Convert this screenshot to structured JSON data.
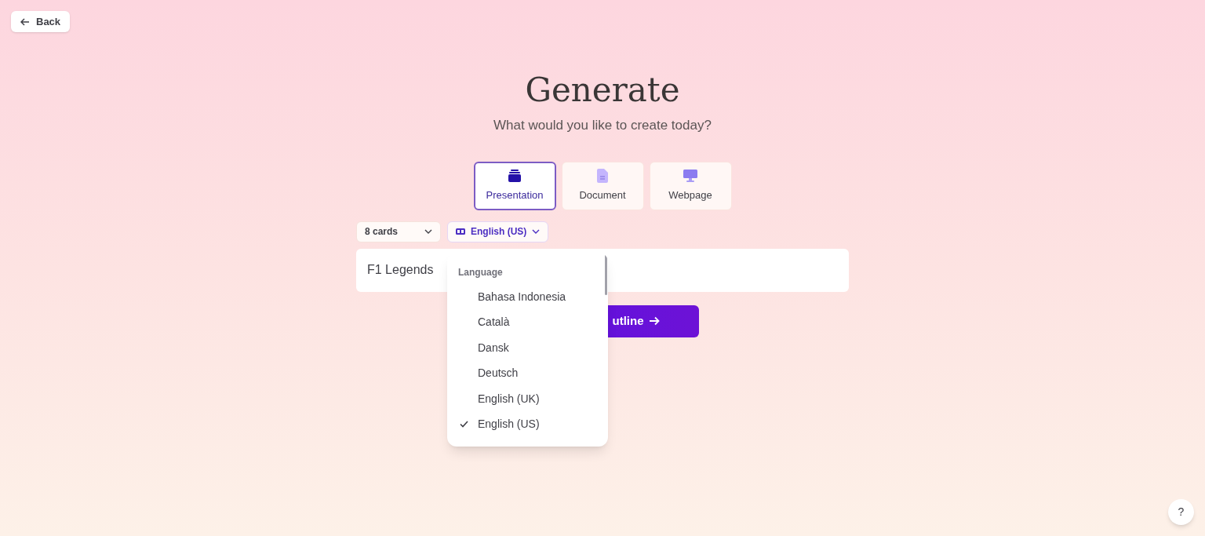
{
  "back_button": {
    "label": "Back"
  },
  "title": "Generate",
  "subtitle": "What would you like to create today?",
  "types": [
    {
      "label": "Presentation",
      "kind": "presentation",
      "selected": true
    },
    {
      "label": "Document",
      "kind": "document",
      "selected": false
    },
    {
      "label": "Webpage",
      "kind": "webpage",
      "selected": false
    }
  ],
  "card_count": {
    "value": "8 cards"
  },
  "language_select": {
    "value": "English (US)",
    "expanded": true
  },
  "prompt": {
    "value": "F1 Legends"
  },
  "generate_button": {
    "label": "utline"
  },
  "language_menu": {
    "heading": "Language",
    "items": [
      {
        "label": "Bahasa Indonesia",
        "selected": false
      },
      {
        "label": "Català",
        "selected": false
      },
      {
        "label": "Dansk",
        "selected": false
      },
      {
        "label": "Deutsch",
        "selected": false
      },
      {
        "label": "English (UK)",
        "selected": false
      },
      {
        "label": "English (US)",
        "selected": true
      }
    ]
  },
  "help_button": {
    "label": "?"
  }
}
